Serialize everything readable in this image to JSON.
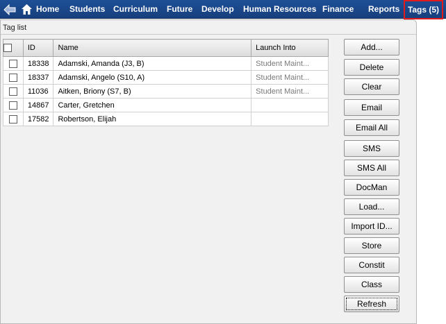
{
  "nav": {
    "back_icon": "back-arrow-icon",
    "home_icon": "home-icon",
    "items": [
      "Home",
      "Students",
      "Curriculum",
      "Future",
      "Develop",
      "Human Resources",
      "Finance",
      "Reports"
    ],
    "tags_label": "Tags (5)",
    "highlight_color": "#e21a1a",
    "bar_color": "#1e4f96"
  },
  "panel": {
    "title": "Tag list"
  },
  "table": {
    "columns": [
      "",
      "ID",
      "Name",
      "Launch Into"
    ],
    "rows": [
      {
        "checked": false,
        "id": "18338",
        "name": "Adamski, Amanda (J3, B)",
        "launch": "Student Maint..."
      },
      {
        "checked": false,
        "id": "18337",
        "name": "Adamski, Angelo (S10, A)",
        "launch": "Student Maint..."
      },
      {
        "checked": false,
        "id": "11036",
        "name": "Aitken, Briony (S7, B)",
        "launch": "Student Maint..."
      },
      {
        "checked": false,
        "id": "14867",
        "name": "Carter, Gretchen",
        "launch": ""
      },
      {
        "checked": false,
        "id": "17582",
        "name": "Robertson, Elijah",
        "launch": ""
      }
    ]
  },
  "buttons": [
    "Add...",
    "Delete",
    "Clear",
    "Email",
    "Email All",
    "SMS",
    "SMS All",
    "DocMan",
    "Load...",
    "Import ID...",
    "Store",
    "Constit",
    "Class",
    "Refresh"
  ]
}
